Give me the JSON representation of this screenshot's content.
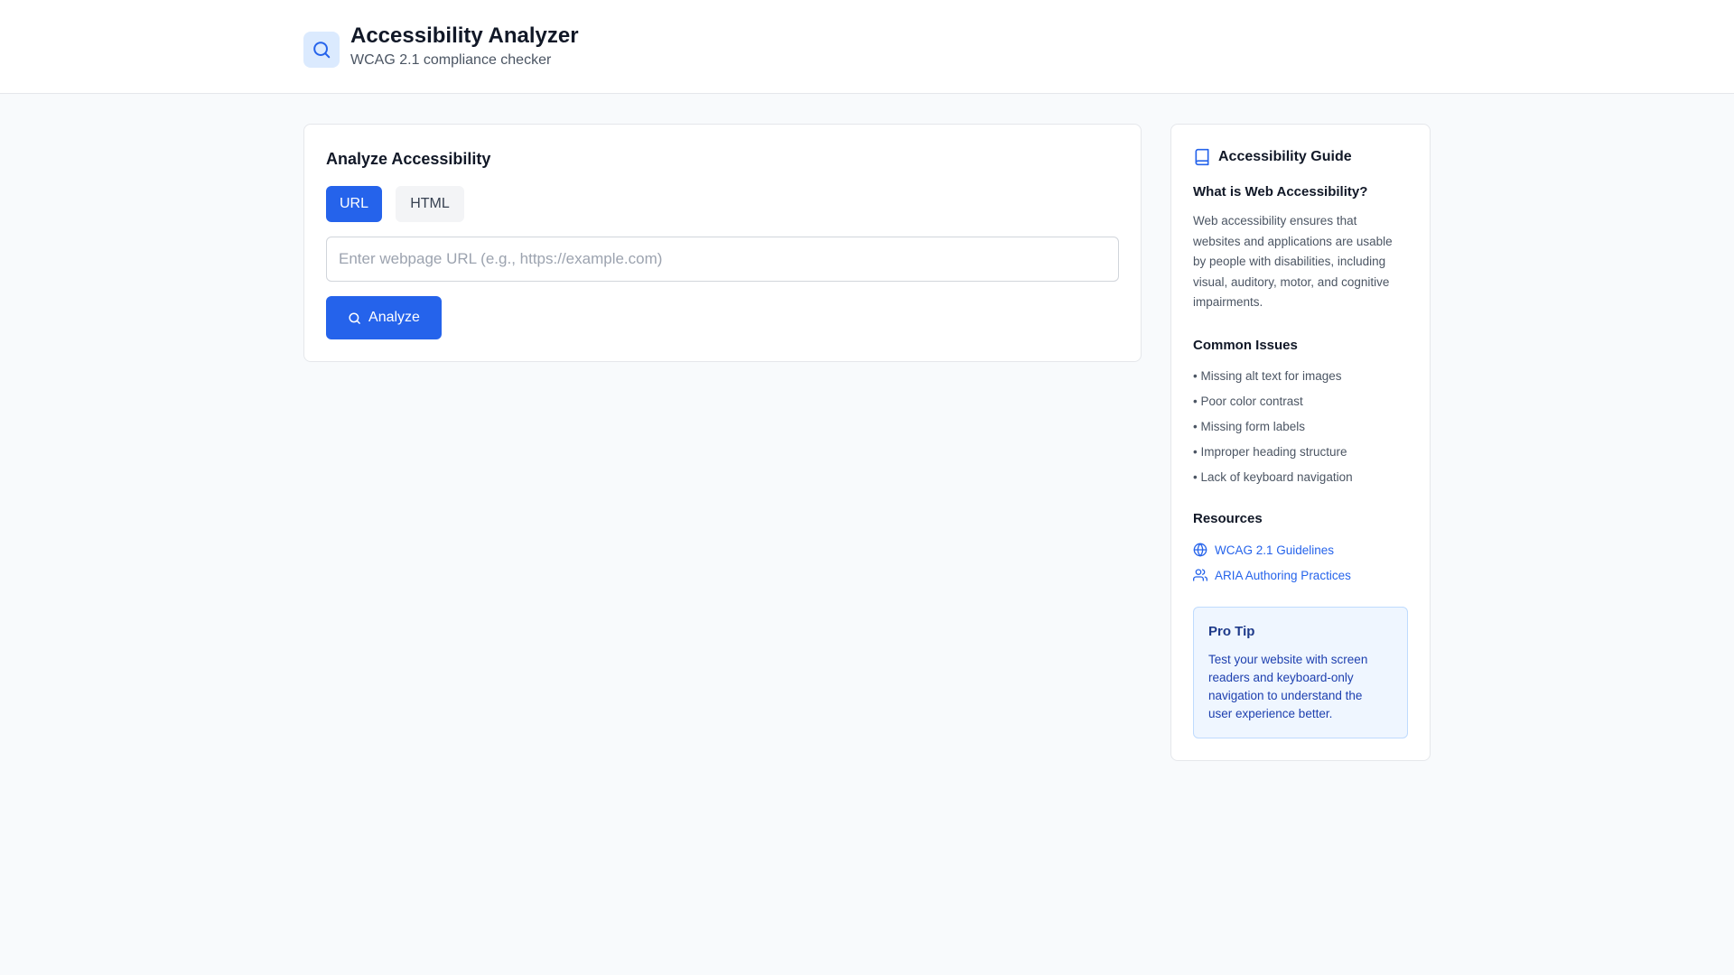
{
  "header": {
    "title": "Accessibility Analyzer",
    "subtitle": "WCAG 2.1 compliance checker",
    "logo_icon": "search-icon"
  },
  "analyzer": {
    "title": "Analyze Accessibility",
    "tabs": [
      {
        "label": "URL",
        "selected": true
      },
      {
        "label": "HTML",
        "selected": false
      }
    ],
    "url_input": {
      "value": "",
      "placeholder": "Enter webpage URL (e.g., https://example.com)"
    },
    "analyze_button": {
      "label": "Analyze",
      "icon": "search-icon"
    }
  },
  "guide": {
    "title": "Accessibility Guide",
    "icon": "book-icon",
    "what_is": {
      "heading": "What is Web Accessibility?",
      "lines": [
        "Web accessibility ensures that",
        "websites and applications are usable",
        "by people with disabilities, including",
        "visual, auditory, motor, and cognitive",
        "impairments."
      ]
    },
    "common_issues": {
      "heading": "Common Issues",
      "items": [
        "• Missing alt text for images",
        "• Poor color contrast",
        "• Missing form labels",
        "• Improper heading structure",
        "• Lack of keyboard navigation"
      ]
    },
    "resources": {
      "heading": "Resources",
      "links": [
        {
          "label": "WCAG 2.1 Guidelines",
          "icon": "globe-icon"
        },
        {
          "label": "ARIA Authoring Practices",
          "icon": "users-icon"
        }
      ]
    },
    "pro_tip": {
      "title": "Pro Tip",
      "lines": [
        "Test your website with screen",
        "readers and keyboard-only",
        "navigation to understand the",
        "user experience better."
      ]
    }
  },
  "colors": {
    "accent": "#2563eb",
    "page_background": "#f8fafc",
    "tip_background": "#eff6ff"
  }
}
